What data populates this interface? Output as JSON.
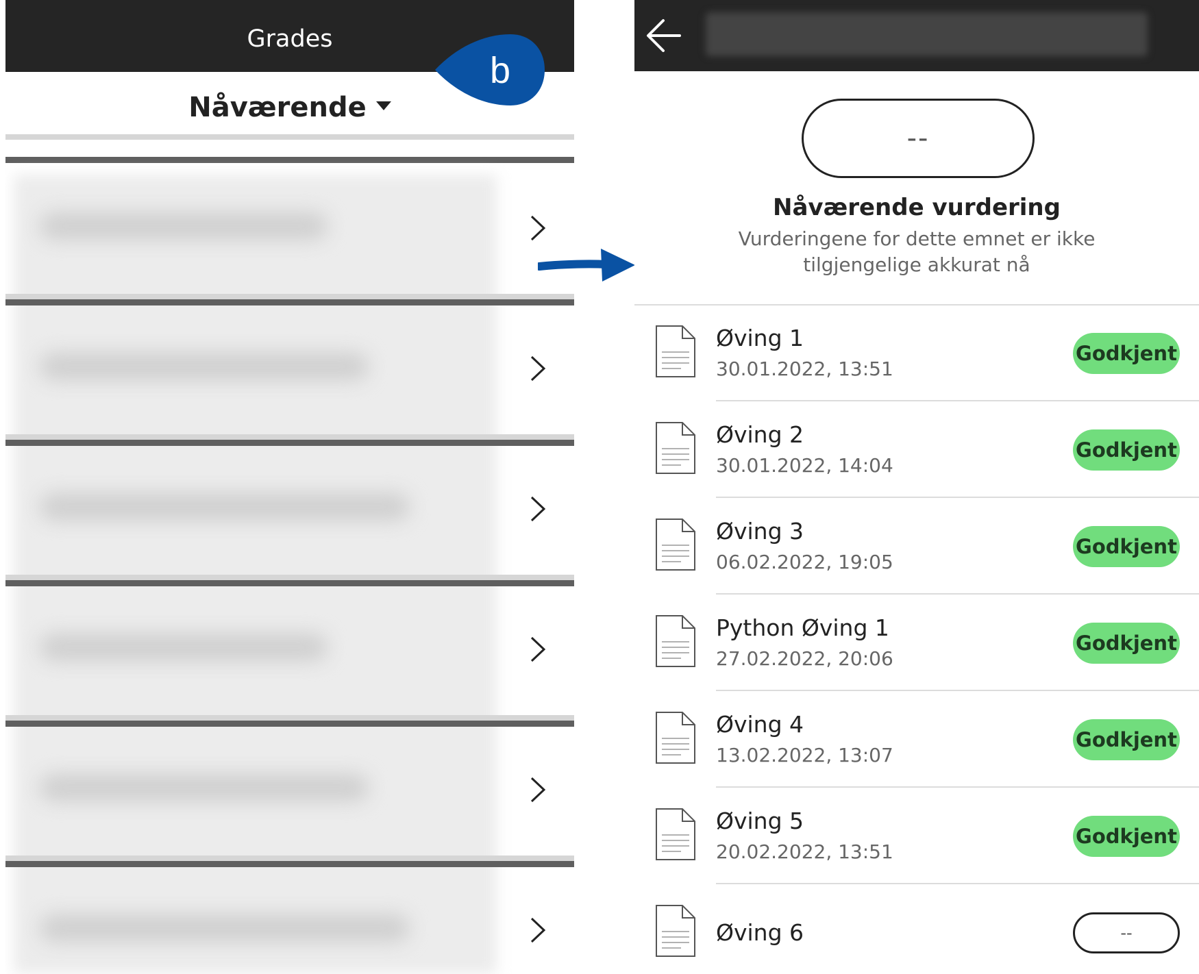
{
  "left": {
    "title": "Grades",
    "period": "Nåværende",
    "rows": 6
  },
  "badge": {
    "letter": "b",
    "color": "#0a52a3"
  },
  "right": {
    "grade": "--",
    "heading": "Nåværende vurdering",
    "description": "Vurderingene for dette emnet er ikke tilgjengelige akkurat nå",
    "assignments": [
      {
        "name": "Øving 1",
        "date": "30.01.2022, 13:51",
        "status": "Godkjent"
      },
      {
        "name": "Øving 2",
        "date": "30.01.2022, 14:04",
        "status": "Godkjent"
      },
      {
        "name": "Øving 3",
        "date": "06.02.2022, 19:05",
        "status": "Godkjent"
      },
      {
        "name": "Python Øving 1",
        "date": "27.02.2022, 20:06",
        "status": "Godkjent"
      },
      {
        "name": "Øving 4",
        "date": "13.02.2022, 13:07",
        "status": "Godkjent"
      },
      {
        "name": "Øving 5",
        "date": "20.02.2022, 13:51",
        "status": "Godkjent"
      },
      {
        "name": "Øving 6",
        "date": "",
        "status": "--"
      }
    ]
  },
  "colors": {
    "header": "#252525",
    "approved": "#71dd7d",
    "arrow": "#0a52a3"
  }
}
